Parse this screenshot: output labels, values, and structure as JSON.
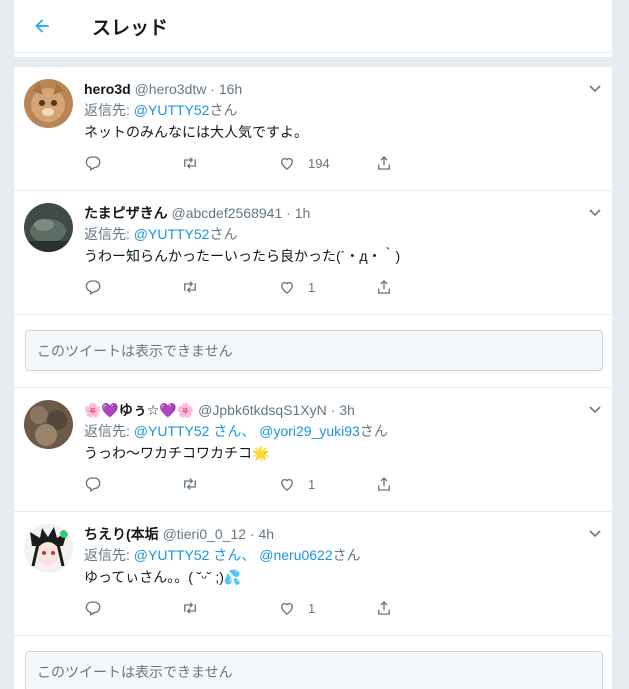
{
  "header": {
    "title": "スレッド"
  },
  "unavailable_text": "このツイートは表示できません",
  "tweets": [
    {
      "name": "hero3d",
      "handle": "@hero3dtw",
      "time": "16h",
      "reply_prefix": "返信先: ",
      "reply_to": "@YUTTY52",
      "reply_suffix": "さん",
      "reply_to2": "",
      "reply_sep": "",
      "reply_suffix2": "",
      "text": "ネットのみんなには大人気ですよ。",
      "likes": "194"
    },
    {
      "name": "たまピザきん",
      "handle": "@abcdef2568941",
      "time": "1h",
      "reply_prefix": "返信先: ",
      "reply_to": "@YUTTY52",
      "reply_suffix": "さん",
      "reply_to2": "",
      "reply_sep": "",
      "reply_suffix2": "",
      "text": "うわー知らんかったーいったら良かった(´・д・｀)",
      "likes": "1"
    },
    {
      "name": "🌸💜ゆぅ☆💜🌸",
      "handle": "@Jpbk6tkdsqS1XyN",
      "time": "3h",
      "reply_prefix": "返信先: ",
      "reply_to": "@YUTTY52 さん、",
      "reply_suffix": "",
      "reply_to2": "@yori29_yuki93",
      "reply_sep": " ",
      "reply_suffix2": "さん",
      "text": "うっわ〜ワカチコワカチコ🌟",
      "likes": "1"
    },
    {
      "name": "ちえり(本垢",
      "handle": "@tieri0_0_12",
      "time": "4h",
      "reply_prefix": "返信先: ",
      "reply_to": "@YUTTY52 さん、",
      "reply_suffix": "",
      "reply_to2": "@neru0622",
      "reply_sep": " ",
      "reply_suffix2": "さん",
      "text": "ゆってぃさん。。( ˘ᵕ˘ ;)💦",
      "likes": "1"
    }
  ],
  "colors": {
    "accent": "#1da1f2",
    "link": "#1b95e0",
    "muted": "#657786"
  }
}
